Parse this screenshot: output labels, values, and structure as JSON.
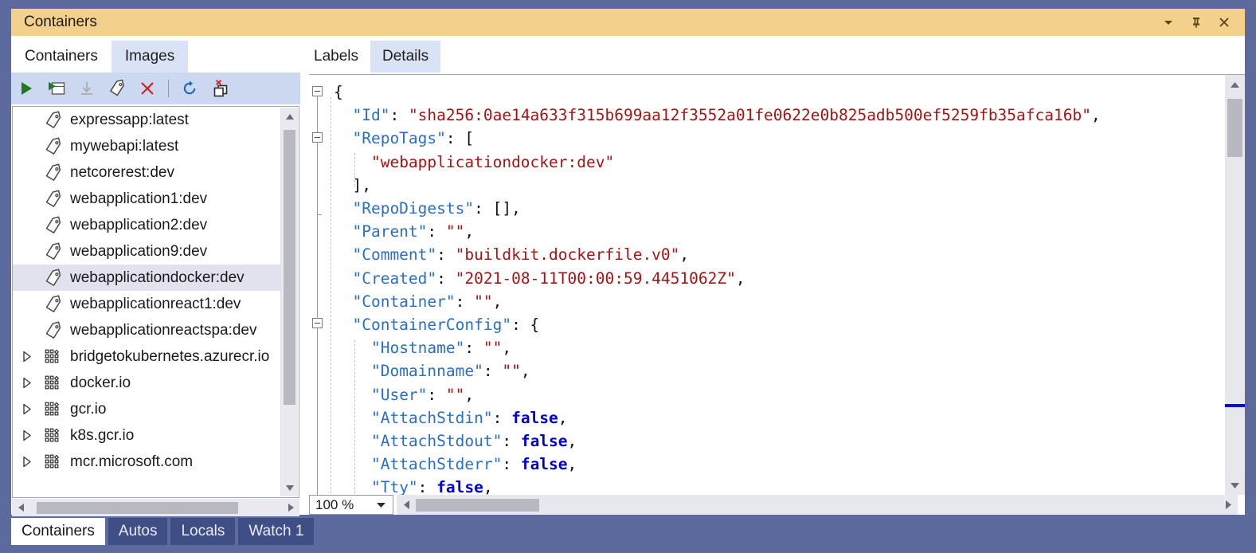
{
  "window": {
    "title": "Containers",
    "buttons": [
      {
        "name": "window-dropdown-button",
        "icon": "chevron-down-icon"
      },
      {
        "name": "auto-hide-pin-button",
        "icon": "pin-icon"
      },
      {
        "name": "close-window-button",
        "icon": "close-icon"
      }
    ]
  },
  "left_pane": {
    "tabs": [
      {
        "label": "Containers",
        "selected": false
      },
      {
        "label": "Images",
        "selected": true
      }
    ],
    "toolbar": [
      {
        "name": "run-button",
        "icon": "play-icon",
        "enabled": true
      },
      {
        "name": "run-with-window-button",
        "icon": "run-window-icon",
        "enabled": true
      },
      {
        "name": "pull-image-button",
        "icon": "download-icon",
        "enabled": false
      },
      {
        "name": "tag-image-button",
        "icon": "tag-icon",
        "enabled": true
      },
      {
        "name": "remove-image-button",
        "icon": "close-x-icon",
        "enabled": true
      },
      {
        "name": "refresh-button",
        "icon": "refresh-icon",
        "enabled": true
      },
      {
        "name": "prune-images-button",
        "icon": "prune-images-icon",
        "enabled": true
      }
    ],
    "items": [
      {
        "label": "expressapp:latest",
        "icon": "tag-icon",
        "kind": "image",
        "expandable": false,
        "selected": false
      },
      {
        "label": "mywebapi:latest",
        "icon": "tag-icon",
        "kind": "image",
        "expandable": false,
        "selected": false
      },
      {
        "label": "netcorerest:dev",
        "icon": "tag-icon",
        "kind": "image",
        "expandable": false,
        "selected": false
      },
      {
        "label": "webapplication1:dev",
        "icon": "tag-icon",
        "kind": "image",
        "expandable": false,
        "selected": false
      },
      {
        "label": "webapplication2:dev",
        "icon": "tag-icon",
        "kind": "image",
        "expandable": false,
        "selected": false
      },
      {
        "label": "webapplication9:dev",
        "icon": "tag-icon",
        "kind": "image",
        "expandable": false,
        "selected": false
      },
      {
        "label": "webapplicationdocker:dev",
        "icon": "tag-icon",
        "kind": "image",
        "expandable": false,
        "selected": true
      },
      {
        "label": "webapplicationreact1:dev",
        "icon": "tag-icon",
        "kind": "image",
        "expandable": false,
        "selected": false
      },
      {
        "label": "webapplicationreactspa:dev",
        "icon": "tag-icon",
        "kind": "image",
        "expandable": false,
        "selected": false
      },
      {
        "label": "bridgetokubernetes.azurecr.io",
        "icon": "registry-icon",
        "kind": "registry",
        "expandable": true,
        "selected": false
      },
      {
        "label": "docker.io",
        "icon": "registry-icon",
        "kind": "registry",
        "expandable": true,
        "selected": false
      },
      {
        "label": "gcr.io",
        "icon": "registry-icon",
        "kind": "registry",
        "expandable": true,
        "selected": false
      },
      {
        "label": "k8s.gcr.io",
        "icon": "registry-icon",
        "kind": "registry",
        "expandable": true,
        "selected": false
      },
      {
        "label": "mcr.microsoft.com",
        "icon": "registry-icon",
        "kind": "registry",
        "expandable": true,
        "selected": false
      }
    ]
  },
  "right_pane": {
    "tabs": [
      {
        "label": "Labels",
        "selected": false
      },
      {
        "label": "Details",
        "selected": true
      }
    ],
    "zoom": "100 %",
    "code_lines": [
      [
        {
          "t": "{",
          "c": "p"
        }
      ],
      [
        {
          "t": "  ",
          "c": "p"
        },
        {
          "t": "\"Id\"",
          "c": "k"
        },
        {
          "t": ": ",
          "c": "p"
        },
        {
          "t": "\"sha256:0ae14a633f315b699aa12f3552a01fe0622e0b825adb500ef5259fb35afca16b\"",
          "c": "s"
        },
        {
          "t": ",",
          "c": "p"
        }
      ],
      [
        {
          "t": "  ",
          "c": "p"
        },
        {
          "t": "\"RepoTags\"",
          "c": "k"
        },
        {
          "t": ": [",
          "c": "p"
        }
      ],
      [
        {
          "t": "    ",
          "c": "p"
        },
        {
          "t": "\"webapplicationdocker:dev\"",
          "c": "s"
        }
      ],
      [
        {
          "t": "  ],",
          "c": "p"
        }
      ],
      [
        {
          "t": "  ",
          "c": "p"
        },
        {
          "t": "\"RepoDigests\"",
          "c": "k"
        },
        {
          "t": ": [],",
          "c": "p"
        }
      ],
      [
        {
          "t": "  ",
          "c": "p"
        },
        {
          "t": "\"Parent\"",
          "c": "k"
        },
        {
          "t": ": ",
          "c": "p"
        },
        {
          "t": "\"\"",
          "c": "s"
        },
        {
          "t": ",",
          "c": "p"
        }
      ],
      [
        {
          "t": "  ",
          "c": "p"
        },
        {
          "t": "\"Comment\"",
          "c": "k"
        },
        {
          "t": ": ",
          "c": "p"
        },
        {
          "t": "\"buildkit.dockerfile.v0\"",
          "c": "s"
        },
        {
          "t": ",",
          "c": "p"
        }
      ],
      [
        {
          "t": "  ",
          "c": "p"
        },
        {
          "t": "\"Created\"",
          "c": "k"
        },
        {
          "t": ": ",
          "c": "p"
        },
        {
          "t": "\"2021-08-11T00:00:59.4451062Z\"",
          "c": "s"
        },
        {
          "t": ",",
          "c": "p"
        }
      ],
      [
        {
          "t": "  ",
          "c": "p"
        },
        {
          "t": "\"Container\"",
          "c": "k"
        },
        {
          "t": ": ",
          "c": "p"
        },
        {
          "t": "\"\"",
          "c": "s"
        },
        {
          "t": ",",
          "c": "p"
        }
      ],
      [
        {
          "t": "  ",
          "c": "p"
        },
        {
          "t": "\"ContainerConfig\"",
          "c": "k"
        },
        {
          "t": ": {",
          "c": "p"
        }
      ],
      [
        {
          "t": "    ",
          "c": "p"
        },
        {
          "t": "\"Hostname\"",
          "c": "k"
        },
        {
          "t": ": ",
          "c": "p"
        },
        {
          "t": "\"\"",
          "c": "s"
        },
        {
          "t": ",",
          "c": "p"
        }
      ],
      [
        {
          "t": "    ",
          "c": "p"
        },
        {
          "t": "\"Domainname\"",
          "c": "k"
        },
        {
          "t": ": ",
          "c": "p"
        },
        {
          "t": "\"\"",
          "c": "s"
        },
        {
          "t": ",",
          "c": "p"
        }
      ],
      [
        {
          "t": "    ",
          "c": "p"
        },
        {
          "t": "\"User\"",
          "c": "k"
        },
        {
          "t": ": ",
          "c": "p"
        },
        {
          "t": "\"\"",
          "c": "s"
        },
        {
          "t": ",",
          "c": "p"
        }
      ],
      [
        {
          "t": "    ",
          "c": "p"
        },
        {
          "t": "\"AttachStdin\"",
          "c": "k"
        },
        {
          "t": ": ",
          "c": "p"
        },
        {
          "t": "false",
          "c": "b"
        },
        {
          "t": ",",
          "c": "p"
        }
      ],
      [
        {
          "t": "    ",
          "c": "p"
        },
        {
          "t": "\"AttachStdout\"",
          "c": "k"
        },
        {
          "t": ": ",
          "c": "p"
        },
        {
          "t": "false",
          "c": "b"
        },
        {
          "t": ",",
          "c": "p"
        }
      ],
      [
        {
          "t": "    ",
          "c": "p"
        },
        {
          "t": "\"AttachStderr\"",
          "c": "k"
        },
        {
          "t": ": ",
          "c": "p"
        },
        {
          "t": "false",
          "c": "b"
        },
        {
          "t": ",",
          "c": "p"
        }
      ],
      [
        {
          "t": "    ",
          "c": "p"
        },
        {
          "t": "\"Tty\"",
          "c": "k"
        },
        {
          "t": ": ",
          "c": "p"
        },
        {
          "t": "false",
          "c": "b"
        },
        {
          "t": ",",
          "c": "p"
        }
      ]
    ]
  },
  "dock_tabs": [
    {
      "label": "Containers",
      "active": true
    },
    {
      "label": "Autos",
      "active": false
    },
    {
      "label": "Locals",
      "active": false
    },
    {
      "label": "Watch 1",
      "active": false
    }
  ],
  "colors": {
    "frame": "#5c6a9e",
    "titlebar": "#f3d08c",
    "tab_selected": "#d9e3f5",
    "toolbar": "#ccd8ef",
    "row_selected": "#e2e2ef",
    "json_key": "#2b6fc0",
    "json_string": "#a31515",
    "json_bool": "#0000d4",
    "marker": "#0a0ad8",
    "dock_tab": "#3f4e85"
  }
}
